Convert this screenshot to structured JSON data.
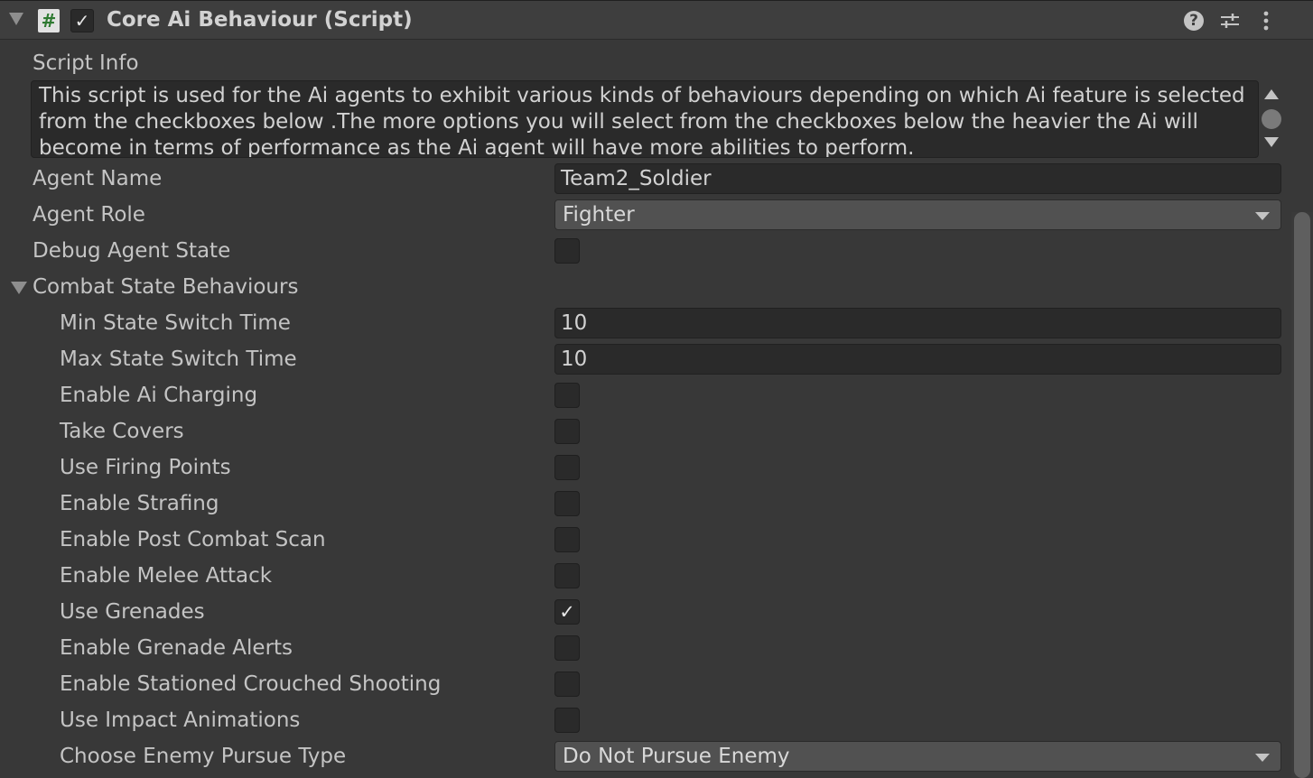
{
  "header": {
    "title": "Core Ai Behaviour (Script)",
    "enabled_check": "✓",
    "script_icon_glyph": "#",
    "help_glyph": "?"
  },
  "script_info": {
    "label": "Script Info",
    "text": "This script is used for the Ai agents to exhibit various kinds of behaviours depending on which Ai feature is selected from the checkboxes below .The more options you will select from the checkboxes below the heavier the Ai will become in terms of performance as the Ai agent will have more abilities to perform."
  },
  "agent_name": {
    "label": "Agent Name",
    "value": "Team2_Soldier"
  },
  "agent_role": {
    "label": "Agent Role",
    "value": "Fighter"
  },
  "debug_agent_state": {
    "label": "Debug Agent State",
    "checked": false
  },
  "combat": {
    "label": "Combat State Behaviours",
    "min_switch": {
      "label": "Min State Switch Time",
      "value": "10"
    },
    "max_switch": {
      "label": "Max State Switch Time",
      "value": "10"
    },
    "toggles": [
      {
        "label": "Enable Ai Charging",
        "check": ""
      },
      {
        "label": "Take Covers",
        "check": ""
      },
      {
        "label": "Use Firing Points",
        "check": ""
      },
      {
        "label": "Enable Strafing",
        "check": ""
      },
      {
        "label": "Enable Post Combat Scan",
        "check": ""
      },
      {
        "label": "Enable Melee Attack",
        "check": ""
      },
      {
        "label": "Use Grenades",
        "check": "✓"
      },
      {
        "label": "Enable Grenade Alerts",
        "check": ""
      },
      {
        "label": "Enable Stationed Crouched Shooting",
        "check": ""
      },
      {
        "label": "Use Impact Animations",
        "check": ""
      }
    ],
    "pursue": {
      "label": "Choose Enemy Pursue Type",
      "value": "Do Not Pursue Enemy"
    }
  },
  "colors": {
    "background": "#383838",
    "field": "#2a2a2a",
    "dropdown": "#515151",
    "text": "#c4c4c4",
    "script_icon_green": "#2f7a32"
  }
}
